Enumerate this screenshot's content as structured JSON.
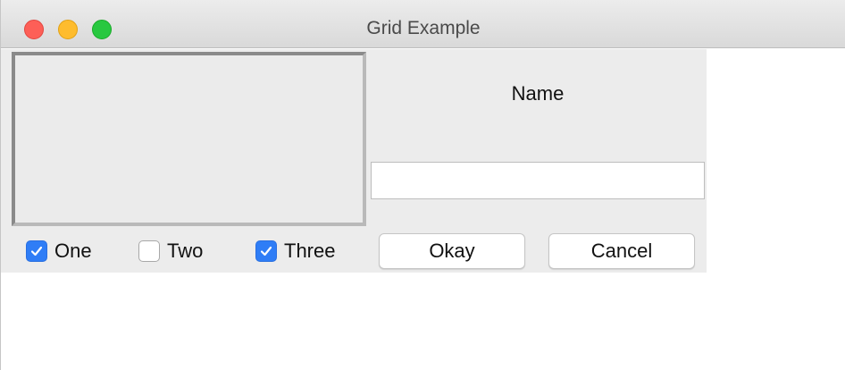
{
  "window": {
    "title": "Grid Example"
  },
  "form": {
    "name_label": "Name",
    "name_value": "",
    "name_placeholder": ""
  },
  "checkboxes": [
    {
      "label": "One",
      "checked": true
    },
    {
      "label": "Two",
      "checked": false
    },
    {
      "label": "Three",
      "checked": true
    }
  ],
  "buttons": {
    "okay_label": "Okay",
    "cancel_label": "Cancel"
  },
  "colors": {
    "accent": "#2f7df6",
    "close": "#fd5f57",
    "minimize": "#febc2e",
    "maximize": "#28c840"
  }
}
